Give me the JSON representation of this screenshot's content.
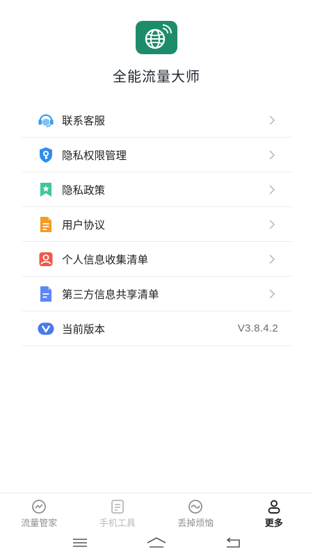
{
  "app": {
    "title": "全能流量大师",
    "logo_icon": "globe-signal-icon",
    "brand_color": "#1e8c6b"
  },
  "menu": {
    "items": [
      {
        "label": "联系客服",
        "icon": "customer-service-icon",
        "color": "#3b9cf0"
      },
      {
        "label": "隐私权限管理",
        "icon": "privacy-shield-icon",
        "color": "#2f8df0"
      },
      {
        "label": "隐私政策",
        "icon": "star-bookmark-icon",
        "color": "#3fc79a"
      },
      {
        "label": "用户协议",
        "icon": "document-icon",
        "color": "#f59a23"
      },
      {
        "label": "个人信息收集清单",
        "icon": "user-card-icon",
        "color": "#f0584a"
      },
      {
        "label": "第三方信息共享清单",
        "icon": "list-document-icon",
        "color": "#5b86f5"
      },
      {
        "label": "当前版本",
        "icon": "version-v-icon",
        "color": "#4a7be8",
        "value": "V3.8.4.2"
      }
    ]
  },
  "tabs": [
    {
      "label": "流量管家",
      "icon": "traffic-chart-icon",
      "state": "normal"
    },
    {
      "label": "手机工具",
      "icon": "tools-list-icon",
      "state": "muted"
    },
    {
      "label": "丢掉烦恼",
      "icon": "wave-circle-icon",
      "state": "normal"
    },
    {
      "label": "更多",
      "icon": "person-icon",
      "state": "active"
    }
  ],
  "system_nav": [
    "menu-icon",
    "home-icon",
    "back-icon"
  ]
}
